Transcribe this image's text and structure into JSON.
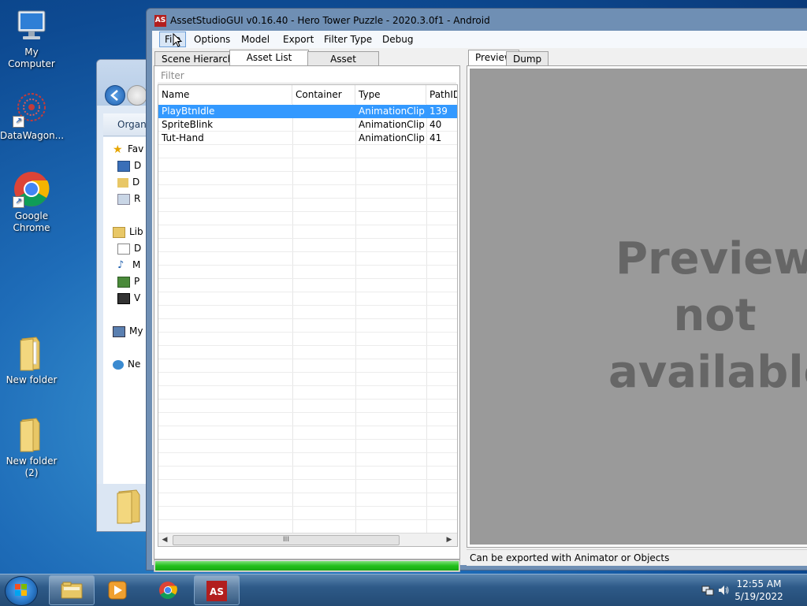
{
  "desktop": {
    "icons": [
      {
        "label": "My Computer"
      },
      {
        "label": "DataWagon..."
      },
      {
        "label": "Google Chrome"
      },
      {
        "label": "New folder"
      },
      {
        "label": "New folder (2)"
      }
    ]
  },
  "explorer": {
    "organize": "Organi",
    "items": [
      "Fav",
      "D",
      "D",
      "R",
      "Lib",
      "D",
      "M",
      "P",
      "V",
      "My",
      "Ne"
    ]
  },
  "app": {
    "title": "AssetStudioGUI v0.16.40 - Hero Tower Puzzle - 2020.3.0f1 - Android",
    "logo": "AS",
    "menu": [
      "File",
      "Options",
      "Model",
      "Export",
      "Filter Type",
      "Debug"
    ],
    "left_tabs": [
      "Scene Hierarchy",
      "Asset List",
      "Asset Classes"
    ],
    "active_left_tab": "Asset List",
    "filter_placeholder": "Filter",
    "columns": [
      "Name",
      "Container",
      "Type",
      "PathID"
    ],
    "rows": [
      {
        "name": "PlayBtnIdle",
        "container": "",
        "type": "AnimationClip",
        "pathid": "139",
        "selected": true
      },
      {
        "name": "SpriteBlink",
        "container": "",
        "type": "AnimationClip",
        "pathid": "40",
        "selected": false
      },
      {
        "name": "Tut-Hand",
        "container": "",
        "type": "AnimationClip",
        "pathid": "41",
        "selected": false
      }
    ],
    "scroll_thumb_glyph": "III",
    "progress_percent": 100,
    "right_tabs": [
      "Preview",
      "Dump"
    ],
    "active_right_tab": "Preview",
    "preview_message": [
      "Preview",
      "not",
      "available"
    ],
    "status_text": "Can be exported with Animator or Objects"
  },
  "taskbar": {
    "time": "12:55 AM",
    "date": "5/19/2022",
    "apps": [
      "explorer",
      "media-player",
      "chrome",
      "assetstudio"
    ]
  },
  "colors": {
    "selection": "#3399ff",
    "progress": "#22c01c",
    "preview_bg": "#9a9a9a",
    "preview_text": "#666666"
  }
}
